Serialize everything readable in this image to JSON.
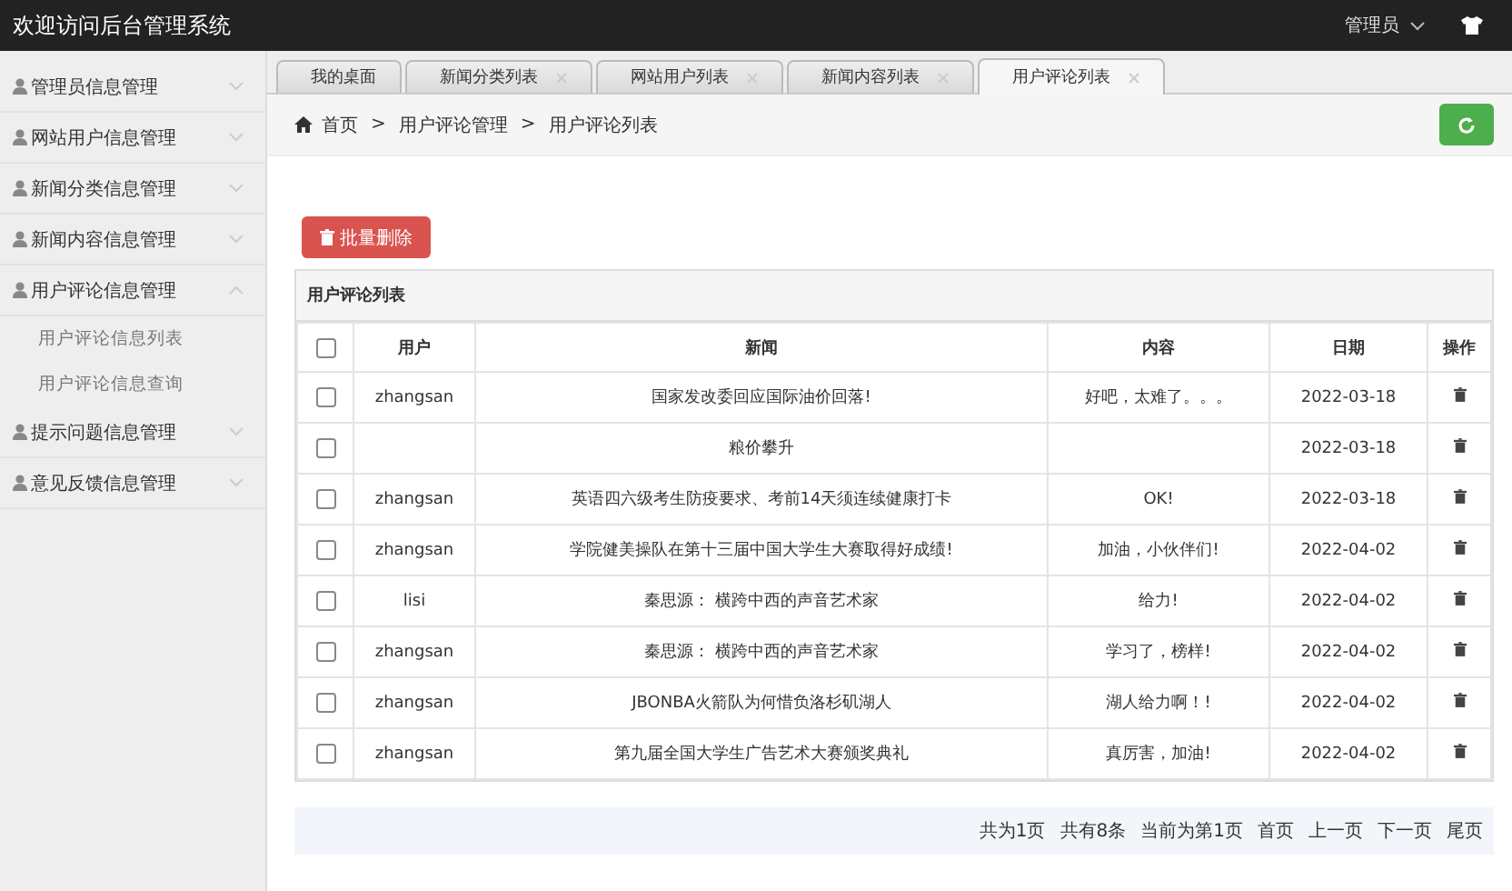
{
  "header": {
    "title": "欢迎访问后台管理系统",
    "user": "管理员"
  },
  "sidebar": {
    "items": [
      {
        "label": "管理员信息管理",
        "expanded": false
      },
      {
        "label": "网站用户信息管理",
        "expanded": false
      },
      {
        "label": "新闻分类信息管理",
        "expanded": false
      },
      {
        "label": "新闻内容信息管理",
        "expanded": false
      },
      {
        "label": "用户评论信息管理",
        "expanded": true,
        "children": [
          {
            "label": "用户评论信息列表"
          },
          {
            "label": "用户评论信息查询"
          }
        ]
      },
      {
        "label": "提示问题信息管理",
        "expanded": false
      },
      {
        "label": "意见反馈信息管理",
        "expanded": false
      }
    ]
  },
  "tabs": [
    {
      "label": "我的桌面",
      "selected": false,
      "closable": false
    },
    {
      "label": "新闻分类列表",
      "selected": false,
      "closable": true
    },
    {
      "label": "网站用户列表",
      "selected": false,
      "closable": true
    },
    {
      "label": "新闻内容列表",
      "selected": false,
      "closable": true
    },
    {
      "label": "用户评论列表",
      "selected": true,
      "closable": true
    }
  ],
  "breadcrumb": [
    "首页",
    "用户评论管理",
    "用户评论列表"
  ],
  "breadcrumb_separator": ">",
  "batch_delete": "批量删除",
  "table": {
    "title": "用户评论列表",
    "select_all_checked": false,
    "columns": [
      "用户",
      "新闻",
      "内容",
      "日期",
      "操作"
    ],
    "rows": [
      {
        "user": "zhangsan",
        "news": "国家发改委回应国际油价回落!",
        "content": "好吧，太难了。。。",
        "date": "2022-03-18",
        "checked": false
      },
      {
        "user": "",
        "news": "粮价攀升",
        "content": "",
        "date": "2022-03-18",
        "checked": false
      },
      {
        "user": "zhangsan",
        "news": "英语四六级考生防疫要求、考前14天须连续健康打卡",
        "content": "OK!",
        "date": "2022-03-18",
        "checked": false
      },
      {
        "user": "zhangsan",
        "news": "学院健美操队在第十三届中国大学生大赛取得好成绩!",
        "content": "加油，小伙伴们!",
        "date": "2022-04-02",
        "checked": false
      },
      {
        "user": "lisi",
        "news": "秦思源： 横跨中西的声音艺术家",
        "content": "给力!",
        "date": "2022-04-02",
        "checked": false
      },
      {
        "user": "zhangsan",
        "news": "秦思源： 横跨中西的声音艺术家",
        "content": "学习了，榜样!",
        "date": "2022-04-02",
        "checked": false
      },
      {
        "user": "zhangsan",
        "news": "JBONBA火箭队为何惜负洛杉矶湖人",
        "content": "湖人给力啊！!",
        "date": "2022-04-02",
        "checked": false
      },
      {
        "user": "zhangsan",
        "news": "第九届全国大学生广告艺术大赛颁奖典礼",
        "content": "真厉害，加油!",
        "date": "2022-04-02",
        "checked": false
      }
    ]
  },
  "pagination": {
    "info": [
      "共为1页",
      "共有8条",
      "当前为第1页"
    ],
    "links": [
      "首页",
      "上一页",
      "下一页",
      "尾页"
    ]
  }
}
